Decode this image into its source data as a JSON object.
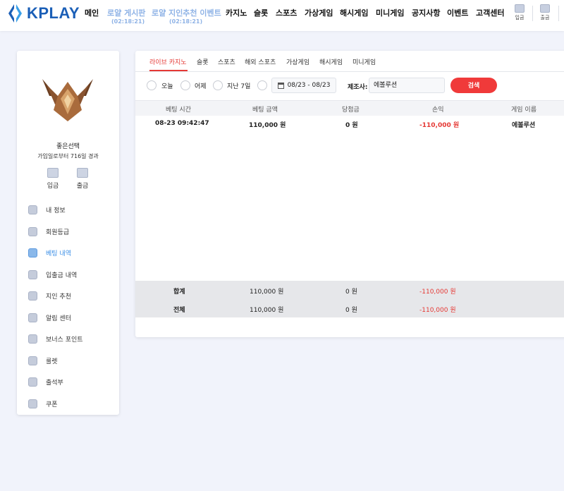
{
  "header": {
    "logo_text": "KPLAY",
    "nav": [
      {
        "label": "메인"
      },
      {
        "label": "로얄 게시판",
        "sub": "(02:18:21)",
        "highlighted": true
      },
      {
        "label": "로얄 지인추천 이벤트",
        "sub": "(02:18:21)",
        "highlighted": true
      },
      {
        "label": "카지노"
      },
      {
        "label": "슬롯"
      },
      {
        "label": "스포츠"
      },
      {
        "label": "가상게임"
      },
      {
        "label": "해시게임"
      },
      {
        "label": "미니게임"
      },
      {
        "label": "공지사항"
      },
      {
        "label": "이벤트"
      },
      {
        "label": "고객센터"
      }
    ],
    "deposit_label": "입금",
    "withdraw_label": "출금"
  },
  "sidebar": {
    "username": "좋은선택",
    "joined_text": "가입일로부터 716일 경과",
    "deposit_label": "입금",
    "withdraw_label": "출금",
    "menu": [
      {
        "label": "내 정보",
        "icon": "user-icon"
      },
      {
        "label": "회원등급",
        "icon": "badge-icon"
      },
      {
        "label": "베팅 내역",
        "icon": "history-icon",
        "active": true
      },
      {
        "label": "입출금 내역",
        "icon": "wallet-icon"
      },
      {
        "label": "지인 추천",
        "icon": "mail-icon"
      },
      {
        "label": "알림 센터",
        "icon": "bell-icon"
      },
      {
        "label": "보너스 포인트",
        "icon": "coin-icon"
      },
      {
        "label": "룰렛",
        "icon": "roulette-icon"
      },
      {
        "label": "출석부",
        "icon": "calendar-icon"
      },
      {
        "label": "쿠폰",
        "icon": "coupon-icon"
      }
    ]
  },
  "tabs": [
    "라이브 카지노",
    "슬롯",
    "스포츠",
    "해외 스포츠",
    "가상게임",
    "해시게임",
    "미니게임"
  ],
  "filter": {
    "options": [
      "오늘",
      "어제",
      "지난 7일"
    ],
    "date_range": "08/23 - 08/23",
    "maker_label": "제조사:",
    "maker_value": "에볼루션",
    "search_label": "검색"
  },
  "table": {
    "columns": [
      "베팅 시간",
      "베팅 금액",
      "당첨금",
      "손익",
      "게임 이름"
    ],
    "rows": [
      {
        "time": "08-23 09:42:47",
        "amount": "110,000 원",
        "win": "0 원",
        "profit": "-110,000 원",
        "game": "에볼루션"
      }
    ],
    "summary": [
      {
        "label": "합계",
        "amount": "110,000 원",
        "win": "0 원",
        "profit": "-110,000 원"
      },
      {
        "label": "전체",
        "amount": "110,000 원",
        "win": "0 원",
        "profit": "-110,000 원"
      }
    ]
  },
  "colors": {
    "accent": "#f03a3a",
    "brand": "#1b5fb7",
    "active_menu": "#3a8ee6",
    "negative": "#e53935"
  }
}
